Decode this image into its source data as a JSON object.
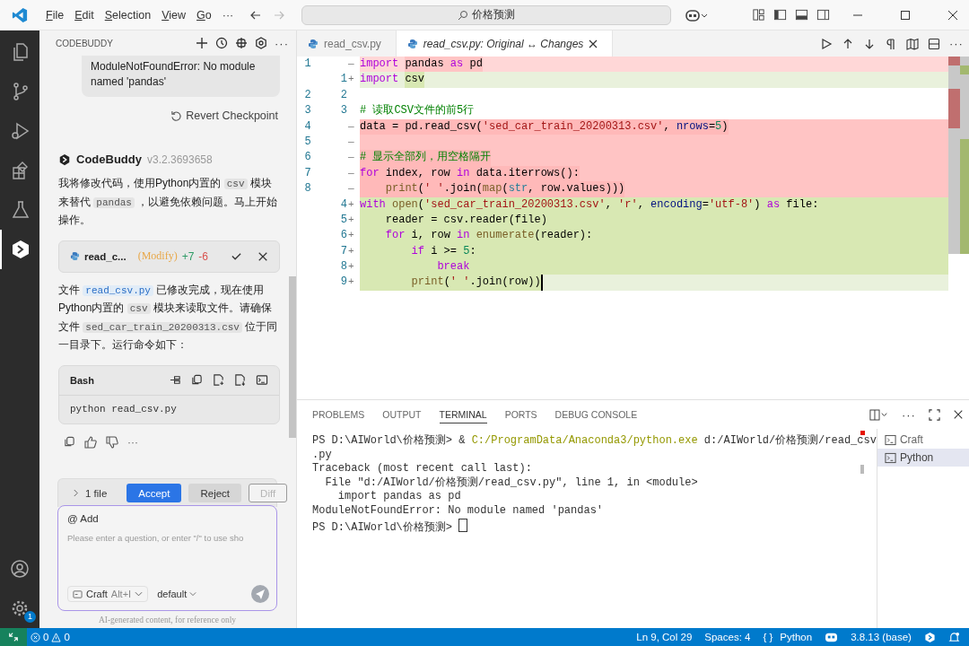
{
  "title_bar": {
    "menus": [
      "File",
      "Edit",
      "Selection",
      "View",
      "Go"
    ],
    "more": "···",
    "search": "价格预测"
  },
  "activity_bar": {
    "items": [
      {
        "kind": "files",
        "selected": false
      },
      {
        "kind": "branch",
        "selected": false
      },
      {
        "kind": "debug",
        "selected": false
      },
      {
        "kind": "extensions",
        "selected": false
      },
      {
        "kind": "flask",
        "selected": false
      },
      {
        "kind": "codebuddy",
        "selected": true
      }
    ],
    "settings_badge": "1"
  },
  "chat": {
    "title": "CODEBUDDY",
    "more": "···",
    "user_message": "ModuleNotFoundError: No module named 'pandas'",
    "revert": "Revert Checkpoint",
    "bot_name": "CodeBuddy",
    "version": "v3.2.3693658",
    "paragraph_1": [
      {
        "kind": "text",
        "text": "我将修改代码，使用Python内置的 "
      },
      {
        "kind": "code",
        "text": "csv"
      },
      {
        "kind": "text",
        "text": " 模块来替代 "
      },
      {
        "kind": "code",
        "text": "pandas"
      },
      {
        "kind": "text",
        "text": " ，以避免依赖问题。马上开始操作。"
      }
    ],
    "change_card": {
      "file": "read_c...",
      "action": "(Modify)",
      "added": "+7",
      "removed": "-6"
    },
    "paragraph_2": [
      {
        "kind": "text",
        "text": "文件 "
      },
      {
        "kind": "link",
        "text": "read_csv.py"
      },
      {
        "kind": "text",
        "text": " 已修改完成，现在使用Python内置的 "
      },
      {
        "kind": "code",
        "text": "csv"
      },
      {
        "kind": "text",
        "text": " 模块来读取文件。请确保文件 "
      },
      {
        "kind": "code",
        "text": "sed_car_train_20200313.csv"
      },
      {
        "kind": "text",
        "text": " 位于同一目录下。运行命令如下："
      }
    ],
    "code_block": {
      "language": "Bash",
      "code": "python read_csv.py"
    },
    "feedback_more": "···",
    "pending": {
      "files": "1 file",
      "buttons": [
        {
          "label": "Accept",
          "kind": "primary",
          "disabled": false
        },
        {
          "label": "Reject",
          "kind": "secondary",
          "disabled": false
        },
        {
          "label": "Diff",
          "kind": "outline",
          "disabled": true
        }
      ]
    },
    "input": {
      "mention": "@ Add",
      "placeholder": "Please enter a question, or enter \"/\" to use sho",
      "mode": "Craft",
      "mode_shortcut": "Alt+I",
      "model": "default"
    },
    "disclaimer": "AI-generated content, for reference only"
  },
  "tabs": [
    {
      "label": "read_csv.py",
      "selected": false,
      "preview": false
    },
    {
      "label": "read_csv.py: Original ↔ Changes",
      "selected": true,
      "preview": true
    }
  ],
  "diff_lines": [
    {
      "kind": "removed",
      "sign": "—",
      "old": "1",
      "full": false,
      "cursor": false,
      "tokens": [
        {
          "text": "import ",
          "kind": "kw"
        },
        {
          "text": "pandas ",
          "kind": "plain",
          "hl": true
        },
        {
          "text": "as",
          "kind": "kw",
          "hl": true
        },
        {
          "text": " pd",
          "kind": "plain",
          "hl": true
        }
      ]
    },
    {
      "kind": "added",
      "sign": "+",
      "new": "1",
      "full": false,
      "cursor": false,
      "tokens": [
        {
          "text": "import ",
          "kind": "kw"
        },
        {
          "text": "csv",
          "kind": "plain",
          "hl": true
        }
      ]
    },
    {
      "kind": "context",
      "old": "2",
      "new": "2",
      "cursor": false
    },
    {
      "kind": "context",
      "old": "3",
      "new": "3",
      "cursor": false,
      "tokens": [
        {
          "text": "# 读取CSV文件的前5行",
          "kind": "cm"
        }
      ]
    },
    {
      "kind": "removed",
      "sign": "—",
      "old": "4",
      "full": true,
      "cursor": false,
      "tokens": [
        {
          "text": "data = pd.read_csv(",
          "kind": "plain"
        },
        {
          "text": "'sed_car_train_20200313.csv'",
          "kind": "str"
        },
        {
          "text": ", ",
          "kind": "plain"
        },
        {
          "text": "nrows",
          "kind": "param"
        },
        {
          "text": "=",
          "kind": "plain"
        },
        {
          "text": "5",
          "kind": "num"
        },
        {
          "text": ")",
          "kind": "plain"
        }
      ]
    },
    {
      "kind": "removed",
      "sign": "—",
      "old": "5",
      "full": true,
      "cursor": false
    },
    {
      "kind": "removed",
      "sign": "—",
      "old": "6",
      "full": true,
      "cursor": false,
      "tokens": [
        {
          "text": "# 显示全部列，用空格隔开",
          "kind": "cm"
        }
      ]
    },
    {
      "kind": "removed",
      "sign": "—",
      "old": "7",
      "full": true,
      "cursor": false,
      "tokens": [
        {
          "text": "for",
          "kind": "kw"
        },
        {
          "text": " index, row ",
          "kind": "plain"
        },
        {
          "text": "in",
          "kind": "kw"
        },
        {
          "text": " data.iterrows():",
          "kind": "plain"
        }
      ]
    },
    {
      "kind": "removed",
      "sign": "—",
      "old": "8",
      "full": true,
      "cursor": false,
      "tokens": [
        {
          "text": "    print",
          "kind": "fn"
        },
        {
          "text": "(",
          "kind": "plain"
        },
        {
          "text": "' '",
          "kind": "str"
        },
        {
          "text": ".join(",
          "kind": "plain"
        },
        {
          "text": "map",
          "kind": "fn"
        },
        {
          "text": "(",
          "kind": "plain"
        },
        {
          "text": "str",
          "kind": "type"
        },
        {
          "text": ", row.values)))",
          "kind": "plain"
        }
      ]
    },
    {
      "kind": "added",
      "sign": "+",
      "new": "4",
      "full": true,
      "cursor": false,
      "tokens": [
        {
          "text": "with",
          "kind": "kw"
        },
        {
          "text": " open",
          "kind": "fn"
        },
        {
          "text": "(",
          "kind": "plain"
        },
        {
          "text": "'sed_car_train_20200313.csv'",
          "kind": "str"
        },
        {
          "text": ", ",
          "kind": "plain"
        },
        {
          "text": "'r'",
          "kind": "str"
        },
        {
          "text": ", ",
          "kind": "plain"
        },
        {
          "text": "encoding",
          "kind": "param"
        },
        {
          "text": "=",
          "kind": "plain"
        },
        {
          "text": "'utf-8'",
          "kind": "str"
        },
        {
          "text": ") ",
          "kind": "plain"
        },
        {
          "text": "as",
          "kind": "kw"
        },
        {
          "text": " file:",
          "kind": "plain"
        }
      ]
    },
    {
      "kind": "added",
      "sign": "+",
      "new": "5",
      "full": true,
      "cursor": false,
      "tokens": [
        {
          "text": "    reader = csv.reader(file)",
          "kind": "plain"
        }
      ]
    },
    {
      "kind": "added",
      "sign": "+",
      "new": "6",
      "full": true,
      "cursor": false,
      "tokens": [
        {
          "text": "    for",
          "kind": "kw"
        },
        {
          "text": " i, row ",
          "kind": "plain"
        },
        {
          "text": "in",
          "kind": "kw"
        },
        {
          "text": " enumerate",
          "kind": "fn"
        },
        {
          "text": "(reader):",
          "kind": "plain"
        }
      ]
    },
    {
      "kind": "added",
      "sign": "+",
      "new": "7",
      "full": true,
      "cursor": false,
      "tokens": [
        {
          "text": "        if",
          "kind": "kw"
        },
        {
          "text": " i >= ",
          "kind": "plain"
        },
        {
          "text": "5",
          "kind": "num"
        },
        {
          "text": ":",
          "kind": "plain"
        }
      ]
    },
    {
      "kind": "added",
      "sign": "+",
      "new": "8",
      "full": true,
      "cursor": false,
      "tokens": [
        {
          "text": "            break",
          "kind": "kw"
        }
      ]
    },
    {
      "kind": "added",
      "sign": "+",
      "new": "9",
      "full": false,
      "cursor": true,
      "tokens": [
        {
          "text": "        print",
          "kind": "fn",
          "hl": true
        },
        {
          "text": "(",
          "kind": "plain",
          "hl": true
        },
        {
          "text": "' '",
          "kind": "str",
          "hl": true
        },
        {
          "text": ".join(row))",
          "kind": "plain",
          "hl": true
        }
      ]
    }
  ],
  "panel": {
    "tabs": [
      {
        "label": "PROBLEMS",
        "selected": false
      },
      {
        "label": "OUTPUT",
        "selected": false
      },
      {
        "label": "TERMINAL",
        "selected": true
      },
      {
        "label": "PORTS",
        "selected": false
      },
      {
        "label": "DEBUG CONSOLE",
        "selected": false
      }
    ],
    "more": "···",
    "terminal_lines": [
      [
        {
          "text": "PS D:\\AIWorld\\价格预测> & ",
          "kind": "plain"
        },
        {
          "text": "C:/ProgramData/Anaconda3/python.exe",
          "kind": "path"
        },
        {
          "text": " d:/AIWorld/价格预测/read_csv",
          "kind": "plain"
        }
      ],
      [
        {
          "text": ".py",
          "kind": "plain"
        }
      ],
      [
        {
          "text": "Traceback (most recent call last):",
          "kind": "plain"
        }
      ],
      [
        {
          "text": "  File \"d:/AIWorld/价格预测/read_csv.py\", line 1, in <module>",
          "kind": "plain"
        }
      ],
      [
        {
          "text": "    import pandas as pd",
          "kind": "plain"
        }
      ],
      [
        {
          "text": "ModuleNotFoundError: No module named 'pandas'",
          "kind": "plain"
        }
      ],
      [
        {
          "text": "PS D:\\AIWorld\\价格预测> ",
          "kind": "plain"
        }
      ]
    ],
    "terminals": [
      {
        "label": "Craft",
        "selected": false
      },
      {
        "label": "Python",
        "selected": true
      }
    ]
  },
  "status_bar": {
    "errors": "0",
    "warnings": "0",
    "position": "Ln 9, Col 29",
    "indent": "Spaces: 4",
    "braces": "{ }",
    "language": "Python",
    "interpreter": "3.8.13 (base)"
  }
}
